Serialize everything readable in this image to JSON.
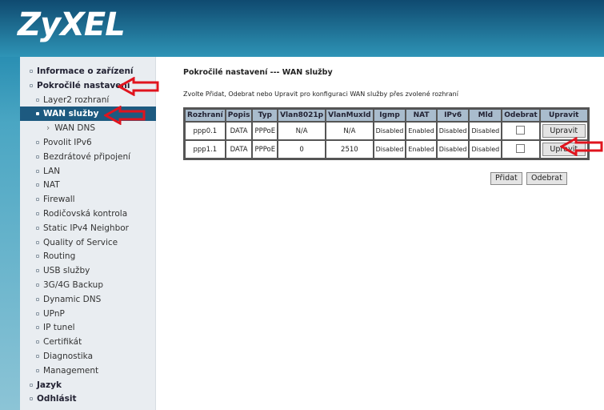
{
  "brand": {
    "logo": "ZyXEL"
  },
  "sidebar": {
    "items": [
      {
        "label": "Informace o zařízení",
        "level": 1
      },
      {
        "label": "Pokročilé nastavení",
        "level": 1
      },
      {
        "label": "Layer2 rozhraní",
        "level": 2
      },
      {
        "label": "WAN služby",
        "level": 2,
        "selected": true
      },
      {
        "label": "WAN DNS",
        "level": 3
      },
      {
        "label": "Povolit IPv6",
        "level": 2
      },
      {
        "label": "Bezdrátové připojení",
        "level": 2
      },
      {
        "label": "LAN",
        "level": 2
      },
      {
        "label": "NAT",
        "level": 2
      },
      {
        "label": "Firewall",
        "level": 2
      },
      {
        "label": "Rodičovská kontrola",
        "level": 2
      },
      {
        "label": "Static IPv4 Neighbor",
        "level": 2
      },
      {
        "label": "Quality of Service",
        "level": 2
      },
      {
        "label": "Routing",
        "level": 2
      },
      {
        "label": "USB služby",
        "level": 2
      },
      {
        "label": "3G/4G Backup",
        "level": 2
      },
      {
        "label": "Dynamic DNS",
        "level": 2
      },
      {
        "label": "UPnP",
        "level": 2
      },
      {
        "label": "IP tunel",
        "level": 2
      },
      {
        "label": "Certifikát",
        "level": 2
      },
      {
        "label": "Diagnostika",
        "level": 2
      },
      {
        "label": "Management",
        "level": 2
      },
      {
        "label": "Jazyk",
        "level": 1
      },
      {
        "label": "Odhlásit",
        "level": 1
      }
    ]
  },
  "main": {
    "title": "Pokročilé nastavení --- WAN služby",
    "description": "Zvolte Přidat, Odebrat nebo Upravit pro konfiguraci WAN služby přes zvolené rozhraní",
    "table": {
      "headers": [
        "Rozhraní",
        "Popis",
        "Typ",
        "Vlan8021p",
        "VlanMuxId",
        "Igmp",
        "NAT",
        "IPv6",
        "Mld",
        "Odebrat",
        "Upravit"
      ],
      "rows": [
        [
          "ppp0.1",
          "DATA",
          "PPPoE",
          "N/A",
          "N/A",
          "Disabled",
          "Enabled",
          "Disabled",
          "Disabled"
        ],
        [
          "ppp1.1",
          "DATA",
          "PPPoE",
          "0",
          "2510",
          "Disabled",
          "Enabled",
          "Disabled",
          "Disabled"
        ]
      ],
      "edit_label": "Upravit"
    },
    "add_label": "Přidat",
    "remove_label": "Odebrat"
  },
  "colors": {
    "annotation_arrow": "#e0141e",
    "selected": "#1d5a80",
    "header_bg": "#a9bccd"
  }
}
